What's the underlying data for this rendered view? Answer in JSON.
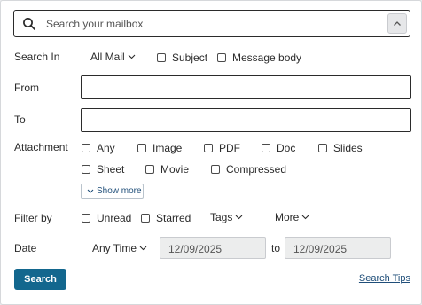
{
  "search": {
    "placeholder": "Search your mailbox",
    "collapse_icon": "chevron-up-icon",
    "search_icon": "search-icon"
  },
  "search_in": {
    "label": "Search In",
    "scope_value": "All Mail",
    "options": [
      "Subject",
      "Message body"
    ]
  },
  "from": {
    "label": "From",
    "value": ""
  },
  "to": {
    "label": "To",
    "value": ""
  },
  "attachment": {
    "label": "Attachment",
    "row1": [
      "Any",
      "Image",
      "PDF",
      "Doc",
      "Slides"
    ],
    "row2": [
      "Sheet",
      "Movie",
      "Compressed"
    ],
    "show_more": "Show more"
  },
  "filter": {
    "label": "Filter by",
    "options": [
      "Unread",
      "Starred"
    ],
    "tags": "Tags",
    "more": "More"
  },
  "date": {
    "label": "Date",
    "range": "Any Time",
    "start": "12/09/2025",
    "to_label": "to",
    "end": "12/09/2025"
  },
  "actions": {
    "search_button": "Search",
    "search_tips": "Search Tips"
  }
}
